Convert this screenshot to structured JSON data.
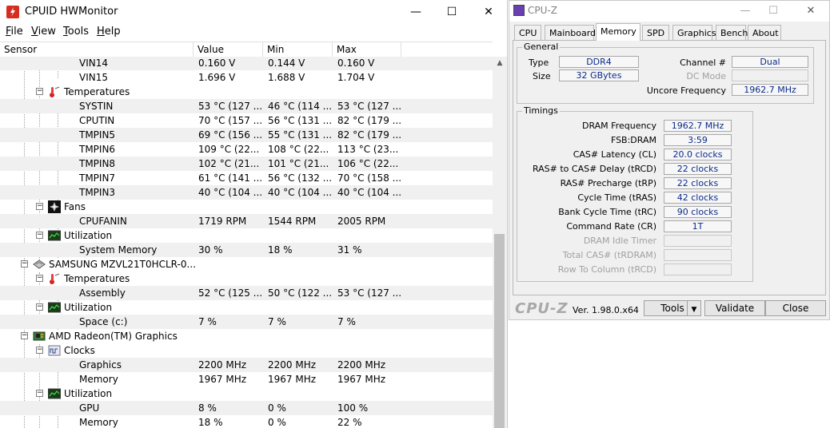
{
  "hwmonitor": {
    "title": "CPUID HWMonitor",
    "menu": [
      "File",
      "View",
      "Tools",
      "Help"
    ],
    "columns": [
      "Sensor",
      "Value",
      "Min",
      "Max"
    ],
    "rows": [
      {
        "name": "VIN14",
        "value": "0.160 V",
        "min": "0.144 V",
        "max": "0.160 V",
        "alt": true
      },
      {
        "name": "VIN15",
        "value": "1.696 V",
        "min": "1.688 V",
        "max": "1.704 V",
        "alt": false
      },
      {
        "name": "Temperatures",
        "value": "",
        "min": "",
        "max": "",
        "alt": false
      },
      {
        "name": "SYSTIN",
        "value": "53 °C  (127 ...",
        "min": "46 °C  (114 ...",
        "max": "53 °C  (127 ...",
        "alt": true
      },
      {
        "name": "CPUTIN",
        "value": "70 °C  (157 ...",
        "min": "56 °C  (131 ...",
        "max": "82 °C  (179 ...",
        "alt": false
      },
      {
        "name": "TMPIN5",
        "value": "69 °C  (156 ...",
        "min": "55 °C  (131 ...",
        "max": "82 °C  (179 ...",
        "alt": true
      },
      {
        "name": "TMPIN6",
        "value": "109 °C  (22...",
        "min": "108 °C  (22...",
        "max": "113 °C  (23...",
        "alt": false
      },
      {
        "name": "TMPIN8",
        "value": "102 °C  (21...",
        "min": "101 °C  (21...",
        "max": "106 °C  (22...",
        "alt": true
      },
      {
        "name": "TMPIN7",
        "value": "61 °C  (141 ...",
        "min": "56 °C  (132 ...",
        "max": "70 °C  (158 ...",
        "alt": false
      },
      {
        "name": "TMPIN3",
        "value": "40 °C  (104 ...",
        "min": "40 °C  (104 ...",
        "max": "40 °C  (104 ...",
        "alt": true
      },
      {
        "name": "Fans",
        "value": "",
        "min": "",
        "max": "",
        "alt": false
      },
      {
        "name": "CPUFANIN",
        "value": "1719 RPM",
        "min": "1544 RPM",
        "max": "2005 RPM",
        "alt": true
      },
      {
        "name": "Utilization",
        "value": "",
        "min": "",
        "max": "",
        "alt": false
      },
      {
        "name": "System Memory",
        "value": "30 %",
        "min": "18 %",
        "max": "31 %",
        "alt": true
      },
      {
        "name": "SAMSUNG MZVL21T0HCLR-0...",
        "value": "",
        "min": "",
        "max": "",
        "alt": false
      },
      {
        "name": "Temperatures",
        "value": "",
        "min": "",
        "max": "",
        "alt": false
      },
      {
        "name": "Assembly",
        "value": "52 °C  (125 ...",
        "min": "50 °C  (122 ...",
        "max": "53 °C  (127 ...",
        "alt": true
      },
      {
        "name": "Utilization",
        "value": "",
        "min": "",
        "max": "",
        "alt": false
      },
      {
        "name": "Space (c:)",
        "value": "7 %",
        "min": "7 %",
        "max": "7 %",
        "alt": true
      },
      {
        "name": "AMD Radeon(TM) Graphics",
        "value": "",
        "min": "",
        "max": "",
        "alt": false
      },
      {
        "name": "Clocks",
        "value": "",
        "min": "",
        "max": "",
        "alt": false
      },
      {
        "name": "Graphics",
        "value": "2200 MHz",
        "min": "2200 MHz",
        "max": "2200 MHz",
        "alt": true
      },
      {
        "name": "Memory",
        "value": "1967 MHz",
        "min": "1967 MHz",
        "max": "1967 MHz",
        "alt": false
      },
      {
        "name": "Utilization",
        "value": "",
        "min": "",
        "max": "",
        "alt": false
      },
      {
        "name": "GPU",
        "value": "8 %",
        "min": "0 %",
        "max": "100 %",
        "alt": true
      },
      {
        "name": "Memory",
        "value": "18 %",
        "min": "0 %",
        "max": "22 %",
        "alt": false
      }
    ]
  },
  "cpuz": {
    "title": "CPU-Z",
    "tabs": [
      "CPU",
      "Mainboard",
      "Memory",
      "SPD",
      "Graphics",
      "Bench",
      "About"
    ],
    "active_tab": "Memory",
    "general": {
      "label": "General",
      "type_label": "Type",
      "type_value": "DDR4",
      "size_label": "Size",
      "size_value": "32 GBytes",
      "channel_label": "Channel #",
      "channel_value": "Dual",
      "dcmode_label": "DC Mode",
      "dcmode_value": "",
      "uncore_label": "Uncore Frequency",
      "uncore_value": "1962.7 MHz"
    },
    "timings": {
      "label": "Timings",
      "items": [
        {
          "label": "DRAM Frequency",
          "value": "1962.7 MHz",
          "dim": false
        },
        {
          "label": "FSB:DRAM",
          "value": "3:59",
          "dim": false
        },
        {
          "label": "CAS# Latency (CL)",
          "value": "20.0 clocks",
          "dim": false
        },
        {
          "label": "RAS# to CAS# Delay (tRCD)",
          "value": "22 clocks",
          "dim": false
        },
        {
          "label": "RAS# Precharge (tRP)",
          "value": "22 clocks",
          "dim": false
        },
        {
          "label": "Cycle Time (tRAS)",
          "value": "42 clocks",
          "dim": false
        },
        {
          "label": "Bank Cycle Time (tRC)",
          "value": "90 clocks",
          "dim": false
        },
        {
          "label": "Command Rate (CR)",
          "value": "1T",
          "dim": false
        },
        {
          "label": "DRAM Idle Timer",
          "value": "",
          "dim": true
        },
        {
          "label": "Total CAS# (tRDRAM)",
          "value": "",
          "dim": true
        },
        {
          "label": "Row To Column (tRCD)",
          "value": "",
          "dim": true
        }
      ]
    },
    "footer": {
      "brand": "CPU-Z",
      "version": "Ver. 1.98.0.x64",
      "tools_label": "Tools",
      "validate_label": "Validate",
      "close_label": "Close"
    }
  }
}
